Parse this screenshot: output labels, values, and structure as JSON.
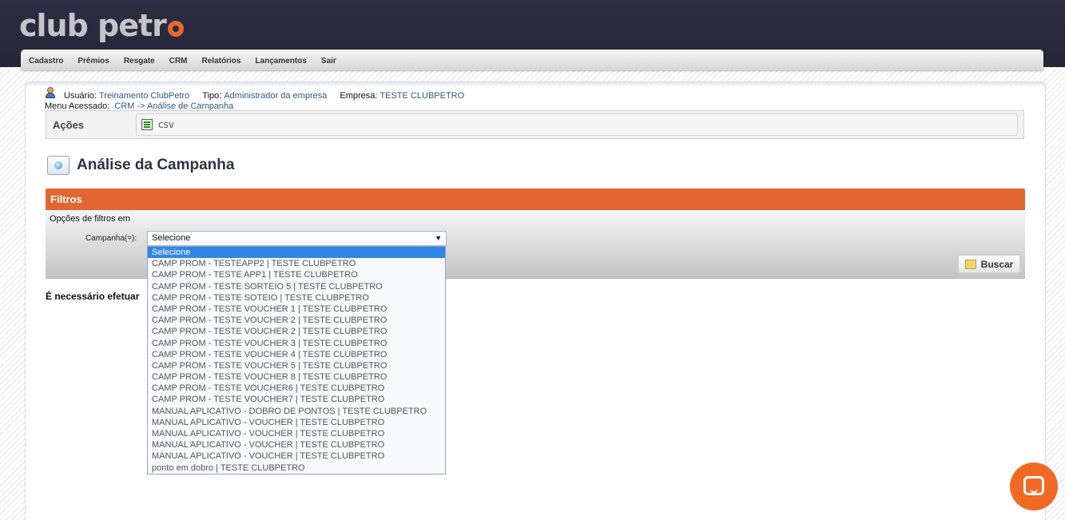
{
  "header": {
    "logo_text": "club petr"
  },
  "menu": {
    "items": [
      {
        "label": "Cadastro"
      },
      {
        "label": "Prêmios"
      },
      {
        "label": "Resgate"
      },
      {
        "label": "CRM"
      },
      {
        "label": "Relatórios"
      },
      {
        "label": "Lançamentos"
      },
      {
        "label": "Sair"
      }
    ]
  },
  "user": {
    "usuario_label": "Usuário:",
    "usuario_value": "Treinamento ClubPetro",
    "tipo_label": "Tipo:",
    "tipo_value": "Administrador da empresa",
    "empresa_label": "Empresa:",
    "empresa_value": "TESTE CLUBPETRO",
    "menu_label": "Menu Acessado:",
    "menu_value": "CRM -> Análise de Campanha"
  },
  "acoes": {
    "label": "Ações",
    "csv_label": "csv"
  },
  "page": {
    "title": "Análise da Campanha"
  },
  "filtros": {
    "header": "Filtros",
    "options_label": "Opções de filtros em",
    "campanha_label": "Campanha(=):",
    "selected_value": "Selecione",
    "buscar_label": "Buscar",
    "options": [
      "Selecione",
      "CAMP PROM - TESTEAPP2 | TESTE CLUBPETRO",
      "CAMP PROM - TESTE APP1 | TESTE CLUBPETRO",
      "CAMP PROM - TESTE SORTEIO 5 | TESTE CLUBPETRO",
      "CAMP PROM - TESTE SOTEIO | TESTE CLUBPETRO",
      "CAMP PROM - TESTE VOUCHER 1 | TESTE CLUBPETRO",
      "CAMP PROM - TESTE VOUCHER 2 | TESTE CLUBPETRO",
      "CAMP PROM - TESTE VOUCHER 2 | TESTE CLUBPETRO",
      "CAMP PROM - TESTE VOUCHER 3 | TESTE CLUBPETRO",
      "CAMP PROM - TESTE VOUCHER 4 | TESTE CLUBPETRO",
      "CAMP PROM - TESTE VOUCHER 5 | TESTE CLUBPETRO",
      "CAMP PROM - TESTE VOUCHER 8 | TESTE CLUBPETRO",
      "CAMP PROM - TESTE VOUCHER6 | TESTE CLUBPETRO",
      "CAMP PROM - TESTE VOUCHER7 | TESTE CLUBPETRO",
      "MANUAL APLICATIVO - DOBRO DE PONTOS | TESTE CLUBPETRO",
      "MANUAL APLICATIVO - VOUCHER | TESTE CLUBPETRO",
      "MANUAL APLICATIVO - VOUCHER | TESTE CLUBPETRO",
      "MANUAL APLICATIVO - VOUCHER | TESTE CLUBPETRO",
      "MANUAL APLICATIVO - VOUCHER | TESTE CLUBPETRO",
      "ponto em dobro | TESTE CLUBPETRO"
    ]
  },
  "message": {
    "warning": "É necessário efetuar"
  },
  "colors": {
    "accent": "#e36531",
    "header_bg": "#2d2d43",
    "selected_option": "#2f86e6",
    "chat_button": "#f06a25"
  }
}
